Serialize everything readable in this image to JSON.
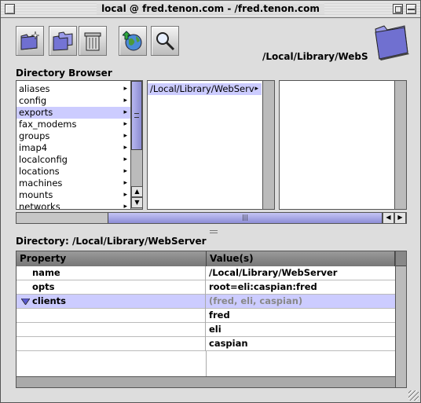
{
  "window": {
    "title": "local @ fred.tenon.com - /fred.tenon.com"
  },
  "toolbar": {
    "buttons": [
      {
        "name": "new-directory",
        "icon": "folder-sparkle-icon"
      },
      {
        "name": "copy-directory",
        "icon": "folders-icon"
      },
      {
        "name": "delete",
        "icon": "trash-icon"
      },
      {
        "name": "refresh-network",
        "icon": "globe-arrow-icon"
      },
      {
        "name": "search",
        "icon": "magnifier-icon"
      }
    ],
    "current_path": "/Local/Library/WebS"
  },
  "browser": {
    "label": "Directory Browser",
    "column1": [
      "aliases",
      "config",
      "exports",
      "fax_modems",
      "groups",
      "imap4",
      "localconfig",
      "locations",
      "machines",
      "mounts",
      "networks"
    ],
    "column1_selected": "exports",
    "column2": [
      "/Local/Library/WebServ"
    ],
    "column3": []
  },
  "directory": {
    "label": "Directory: /Local/Library/WebServer"
  },
  "properties": {
    "headers": {
      "property": "Property",
      "value": "Value(s)"
    },
    "rows": [
      {
        "property": "name",
        "value": "/Local/Library/WebServer"
      },
      {
        "property": "opts",
        "value": "root=eli:caspian:fred"
      },
      {
        "property": "clients",
        "value": "(fred, eli, caspian)"
      },
      {
        "property": "",
        "value": "fred"
      },
      {
        "property": "",
        "value": "eli"
      },
      {
        "property": "",
        "value": "caspian"
      }
    ]
  },
  "colors": {
    "selection": "#ccccff",
    "scroll_thumb": "#9a9ae0"
  }
}
